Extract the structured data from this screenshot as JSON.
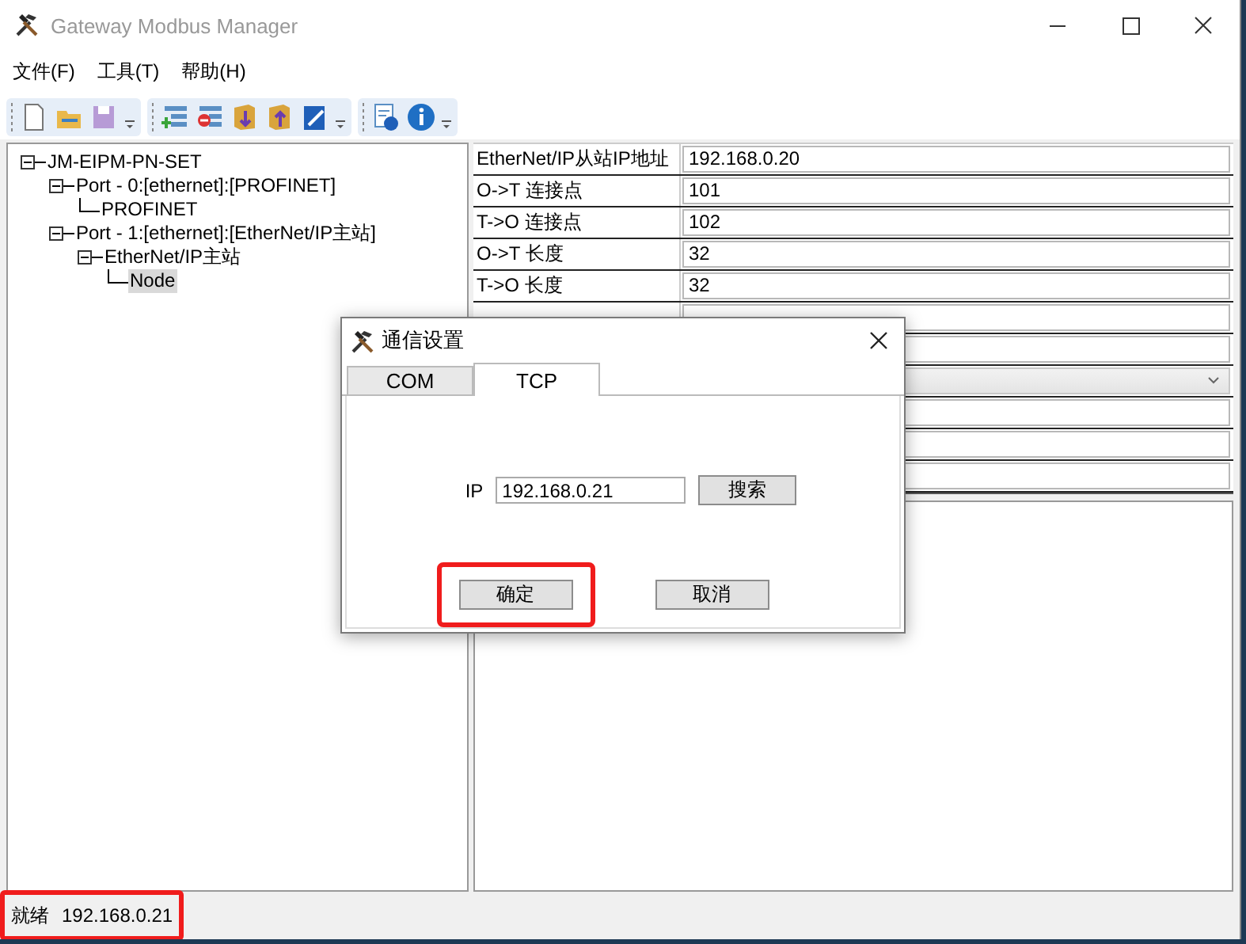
{
  "window": {
    "title": "Gateway Modbus Manager"
  },
  "menu": [
    "文件(F)",
    "工具(T)",
    "帮助(H)"
  ],
  "tree": [
    {
      "label": "JM-EIPM-PN-SET",
      "expanded": true,
      "selected": false,
      "children": [
        {
          "label": "Port - 0:[ethernet]:[PROFINET]",
          "expanded": true,
          "selected": false,
          "children": [
            {
              "label": "PROFINET",
              "selected": false
            }
          ]
        },
        {
          "label": "Port - 1:[ethernet]:[EtherNet/IP主站]",
          "expanded": true,
          "selected": false,
          "children": [
            {
              "label": "EtherNet/IP主站",
              "expanded": true,
              "selected": false,
              "children": [
                {
                  "label": "Node",
                  "selected": true
                }
              ]
            }
          ]
        }
      ]
    }
  ],
  "properties": [
    {
      "kind": "text",
      "label": "EtherNet/IP从站IP地址",
      "value": "192.168.0.20"
    },
    {
      "kind": "text",
      "label": "O->T 连接点",
      "value": "101"
    },
    {
      "kind": "text",
      "label": "T->O 连接点",
      "value": "102"
    },
    {
      "kind": "text",
      "label": "O->T 长度",
      "value": "32"
    },
    {
      "kind": "text",
      "label": "T->O 长度",
      "value": "32"
    },
    {
      "kind": "text"
    },
    {
      "kind": "text"
    },
    {
      "kind": "dropdown"
    },
    {
      "kind": "text"
    },
    {
      "kind": "text"
    },
    {
      "kind": "text"
    }
  ],
  "dialog": {
    "title": "通信设置",
    "tabs": [
      {
        "label": "COM",
        "selected": false
      },
      {
        "label": "TCP",
        "selected": true
      }
    ],
    "ip_label": "IP",
    "ip_value": "192.168.0.21",
    "search_button": "搜索",
    "ok_button": {
      "label": "确定",
      "highlighted": true
    },
    "cancel_button": "取消"
  },
  "status_bar": {
    "highlighted": true,
    "status": "就绪",
    "address": "192.168.0.21"
  }
}
